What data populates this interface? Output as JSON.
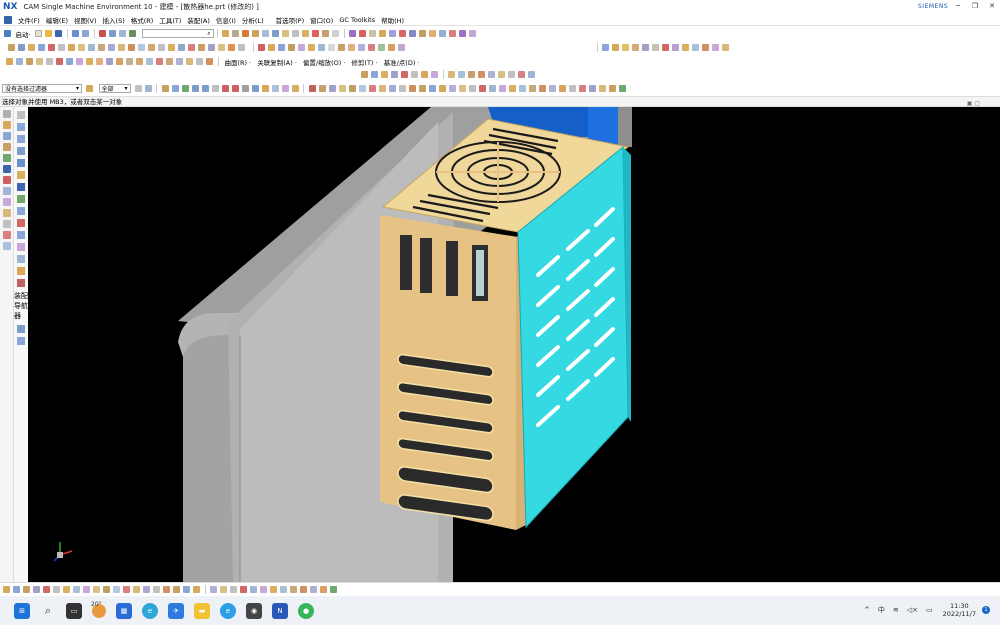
{
  "window": {
    "logo": "NX",
    "title": "CAM Single Machine Environment 10 - 建模 - [散热器he.prt  (修改的) ]",
    "brand": "SIEMENS",
    "min": "─",
    "restore": "❐",
    "close": "✕"
  },
  "menu": {
    "items": [
      "文件(F)",
      "编辑(E)",
      "视图(V)",
      "插入(S)",
      "格式(R)",
      "工具(T)",
      "装配(A)",
      "信息(I)",
      "分析(L)",
      "首选项(P)",
      "窗口(O)",
      "GC Toolkits",
      "帮助(H)"
    ]
  },
  "toolbar1": {
    "start_label": "启动·",
    "command_search_value": "",
    "command_search_placeholder": ""
  },
  "toolbar2": {
    "menus": [
      "曲面(R) ·",
      "关联复制(A) ·",
      "偏置/缩放(O) ·",
      "修剪(T) ·",
      "基准/点(D) ·"
    ]
  },
  "toolbar4": {
    "filter_value": "没有选择过滤器",
    "scope_value": "全部"
  },
  "cue_line": {
    "text": "选择对象并使用 MB3，或者双击某一对象"
  },
  "resource_bar": {
    "label": "装配导航器"
  },
  "taskbar": {
    "weather_temp": "20°",
    "input_method": "中",
    "time": "11:30",
    "date": "2022/11/7",
    "notification_count": "1"
  },
  "colors": {
    "tan_body": "#e8c98a",
    "cyan_side": "#33d8e0",
    "gray_plate": "#a7a7a7",
    "blue_back": "#1560c8",
    "nx_blue": "#1a56b3"
  }
}
